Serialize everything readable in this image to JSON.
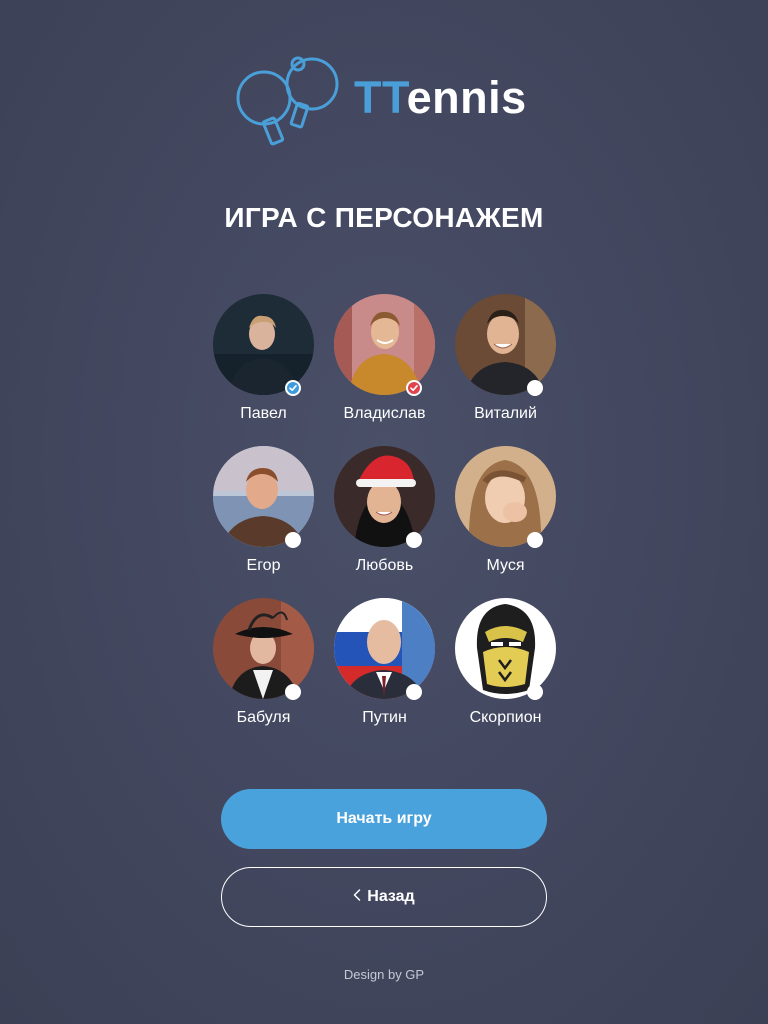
{
  "brand": {
    "name_accent": "TT",
    "name_rest": "ennis",
    "accent_color": "#4a9fd8"
  },
  "page": {
    "title": "ИГРА С ПЕРСОНАЖЕМ"
  },
  "characters": [
    {
      "name": "Павел",
      "selection": "player-1",
      "badge_color": "#3f9bdc"
    },
    {
      "name": "Владислав",
      "selection": "player-2",
      "badge_color": "#e0454f"
    },
    {
      "name": "Виталий",
      "selection": "none"
    },
    {
      "name": "Егор",
      "selection": "none"
    },
    {
      "name": "Любовь",
      "selection": "none"
    },
    {
      "name": "Муся",
      "selection": "none"
    },
    {
      "name": "Бабуля",
      "selection": "none"
    },
    {
      "name": "Путин",
      "selection": "none"
    },
    {
      "name": "Скорпион",
      "selection": "none"
    }
  ],
  "actions": {
    "start_label": "Начать игру",
    "back_label": "Назад",
    "back_icon": "chevron-left-icon"
  },
  "footer": {
    "credit": "Design by GP"
  }
}
